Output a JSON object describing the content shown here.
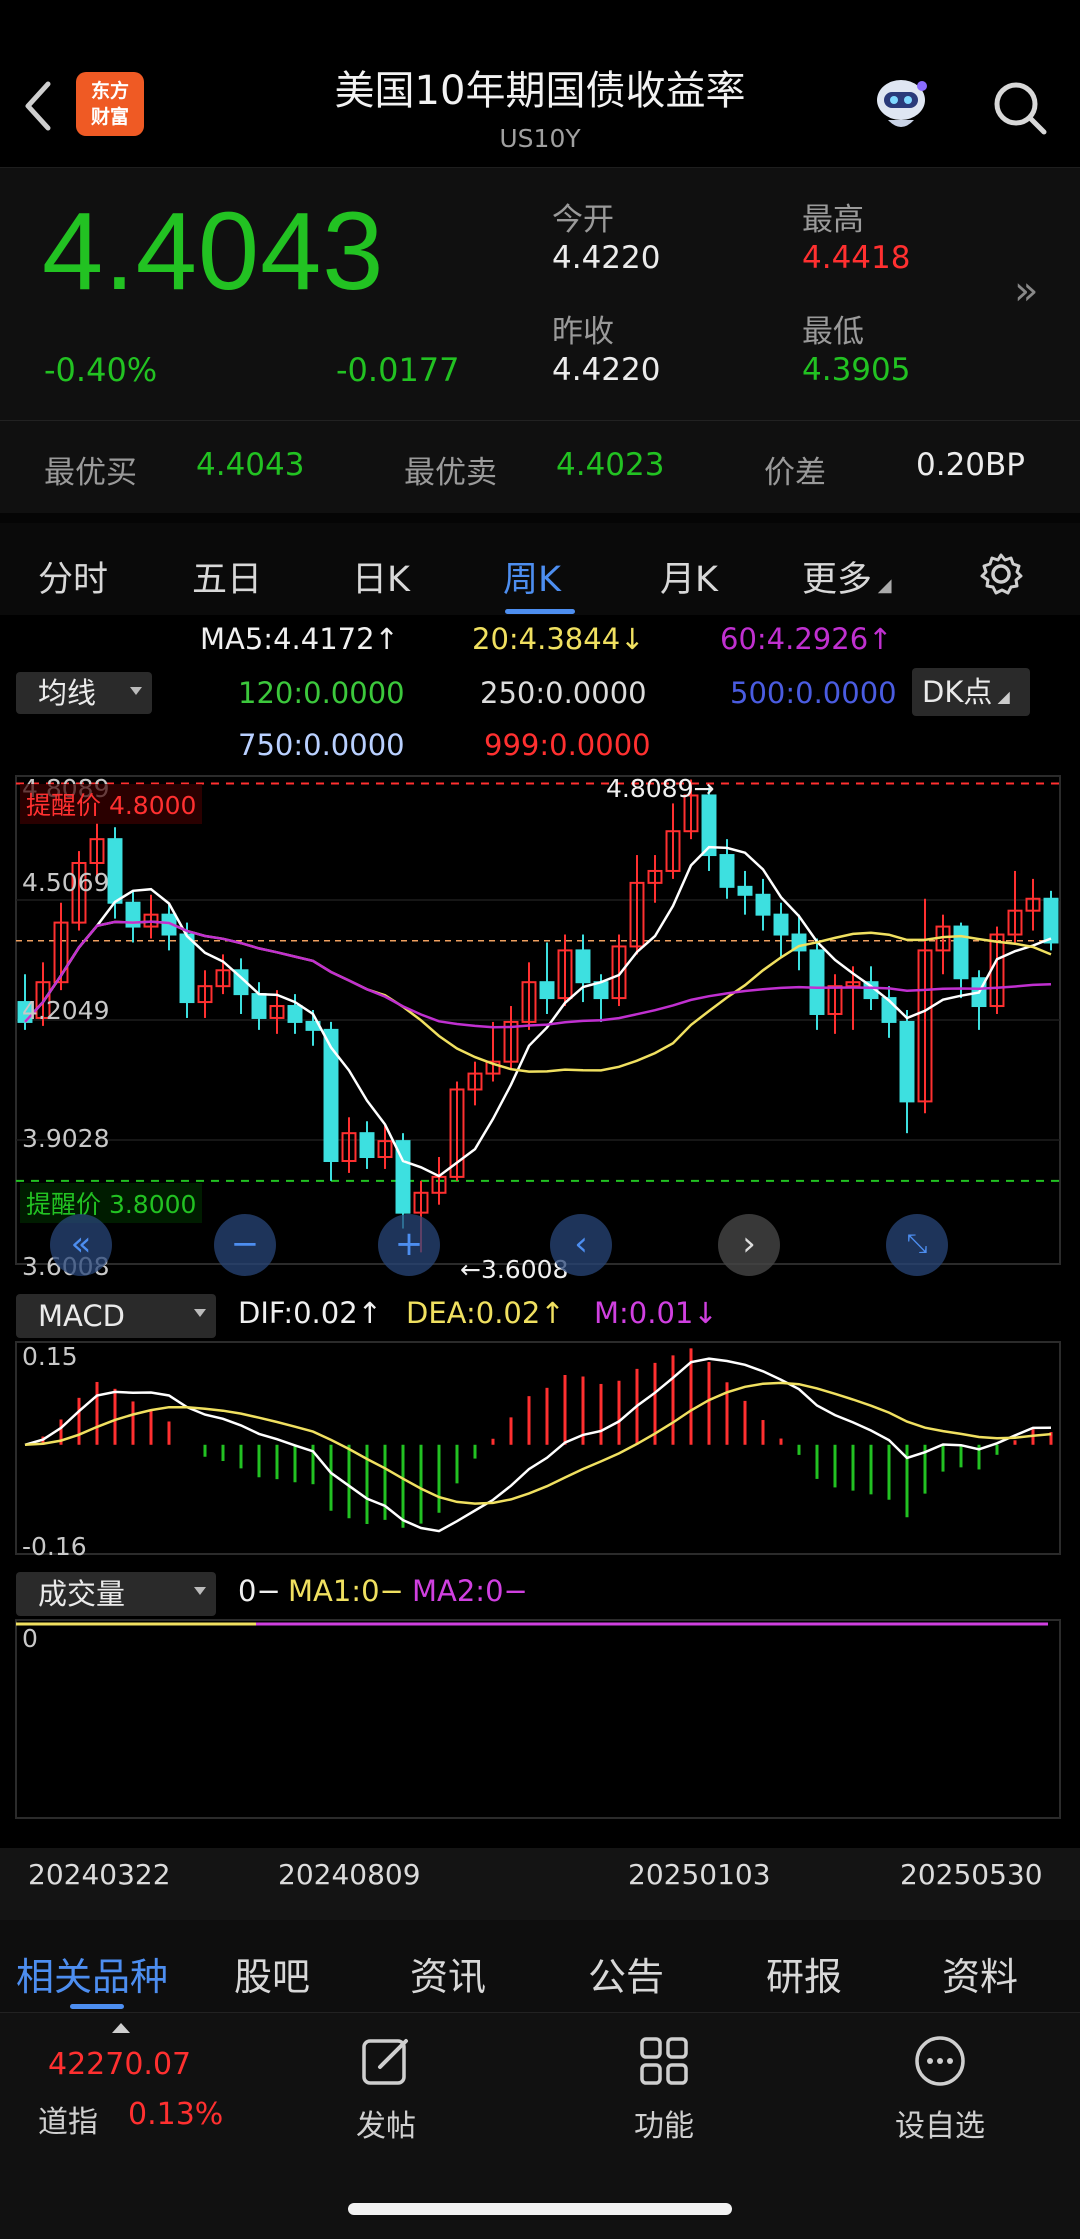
{
  "header": {
    "title": "美国10年期国债收益率",
    "subtitle": "US10Y",
    "logo_text_line1": "东方",
    "logo_text_line2": "财富"
  },
  "quote": {
    "price": "4.4043",
    "change_pct": "-0.40%",
    "change": "-0.0177",
    "open_label": "今开",
    "open": "4.4220",
    "high_label": "最高",
    "high": "4.4418",
    "prev_close_label": "昨收",
    "prev_close": "4.4220",
    "low_label": "最低",
    "low": "4.3905"
  },
  "bidask": {
    "bid_label": "最优买",
    "bid": "4.4043",
    "ask_label": "最优卖",
    "ask": "4.4023",
    "spread_label": "价差",
    "spread": "0.20BP"
  },
  "period_tabs": [
    "分时",
    "五日",
    "日K",
    "周K",
    "月K",
    "更多"
  ],
  "active_period": "周K",
  "ma_legend": {
    "selector": "均线",
    "ma5": "MA5:4.4172↑",
    "ma20": "20:4.3844↓",
    "ma60": "60:4.2926↑",
    "ma120": "120:0.0000",
    "ma250": "250:0.0000",
    "ma500": "500:0.0000",
    "ma750": "750:0.0000",
    "ma999": "999:0.0000",
    "dk_button": "DK点"
  },
  "kline": {
    "y_labels": [
      "4.8089",
      "4.5069",
      "4.2049",
      "3.9028",
      "3.6008"
    ],
    "alert_high": "提醒价 4.8000",
    "alert_low": "提醒价 3.8000",
    "max_marker": "4.8089→",
    "min_marker": "←3.6008",
    "colors": {
      "up": "#ff3030",
      "down": "#3de0e0",
      "ma5": "#ffffff",
      "ma20": "#f0e060",
      "ma60": "#c030d0"
    }
  },
  "macd": {
    "selector": "MACD",
    "dif": "DIF:0.02↑",
    "dea": "DEA:0.02↑",
    "m": "M:0.01↓",
    "y_top": "0.15",
    "y_bottom": "-0.16"
  },
  "volume": {
    "selector": "成交量",
    "value": "0−",
    "ma1": "MA1:0−",
    "ma2": "MA2:0−",
    "y_label": "0"
  },
  "dates": [
    "20240322",
    "20240809",
    "20250103",
    "20250530"
  ],
  "info_tabs": [
    "相关品种",
    "股吧",
    "资讯",
    "公告",
    "研报",
    "资料"
  ],
  "bottom_bar": {
    "index_value": "42270.07",
    "index_name": "道指",
    "index_pct": "0.13%",
    "post_label": "发帖",
    "function_label": "功能",
    "watchlist_label": "设自选"
  },
  "chart_data": {
    "type": "candlestick",
    "title": "",
    "ylim": [
      3.6008,
      4.8089
    ],
    "note_axis": "weekly candles, open/close/high/low in yield %",
    "candles": [
      [
        4.25,
        4.2,
        4.32,
        4.18
      ],
      [
        4.21,
        4.3,
        4.35,
        4.19
      ],
      [
        4.3,
        4.45,
        4.5,
        4.28
      ],
      [
        4.45,
        4.6,
        4.63,
        4.43
      ],
      [
        4.6,
        4.66,
        4.7,
        4.55
      ],
      [
        4.66,
        4.5,
        4.69,
        4.46
      ],
      [
        4.5,
        4.44,
        4.53,
        4.4
      ],
      [
        4.44,
        4.47,
        4.52,
        4.41
      ],
      [
        4.47,
        4.42,
        4.5,
        4.38
      ],
      [
        4.42,
        4.25,
        4.45,
        4.21
      ],
      [
        4.25,
        4.29,
        4.33,
        4.21
      ],
      [
        4.29,
        4.33,
        4.37,
        4.27
      ],
      [
        4.33,
        4.27,
        4.36,
        4.22
      ],
      [
        4.27,
        4.21,
        4.3,
        4.18
      ],
      [
        4.21,
        4.24,
        4.28,
        4.17
      ],
      [
        4.24,
        4.2,
        4.27,
        4.17
      ],
      [
        4.2,
        4.18,
        4.23,
        4.14
      ],
      [
        4.18,
        3.85,
        4.2,
        3.8
      ],
      [
        3.85,
        3.92,
        3.96,
        3.82
      ],
      [
        3.92,
        3.86,
        3.95,
        3.83
      ],
      [
        3.86,
        3.9,
        3.94,
        3.83
      ],
      [
        3.9,
        3.72,
        3.92,
        3.68
      ],
      [
        3.72,
        3.77,
        3.8,
        3.62
      ],
      [
        3.77,
        3.81,
        3.86,
        3.74
      ],
      [
        3.81,
        4.03,
        4.05,
        3.8
      ],
      [
        4.03,
        4.07,
        4.1,
        3.99
      ],
      [
        4.07,
        4.1,
        4.2,
        4.05
      ],
      [
        4.1,
        4.2,
        4.24,
        4.08
      ],
      [
        4.2,
        4.3,
        4.35,
        4.18
      ],
      [
        4.3,
        4.26,
        4.4,
        4.22
      ],
      [
        4.26,
        4.38,
        4.42,
        4.24
      ],
      [
        4.38,
        4.3,
        4.42,
        4.25
      ],
      [
        4.3,
        4.26,
        4.32,
        4.2
      ],
      [
        4.26,
        4.39,
        4.42,
        4.24
      ],
      [
        4.39,
        4.55,
        4.62,
        4.37
      ],
      [
        4.55,
        4.58,
        4.62,
        4.5
      ],
      [
        4.58,
        4.68,
        4.75,
        4.56
      ],
      [
        4.68,
        4.77,
        4.81,
        4.66
      ],
      [
        4.77,
        4.62,
        4.79,
        4.58
      ],
      [
        4.62,
        4.54,
        4.66,
        4.51
      ],
      [
        4.54,
        4.52,
        4.58,
        4.47
      ],
      [
        4.52,
        4.47,
        4.56,
        4.43
      ],
      [
        4.47,
        4.42,
        4.5,
        4.36
      ],
      [
        4.42,
        4.38,
        4.47,
        4.33
      ],
      [
        4.38,
        4.22,
        4.41,
        4.18
      ],
      [
        4.22,
        4.29,
        4.32,
        4.17
      ],
      [
        4.29,
        4.3,
        4.34,
        4.18
      ],
      [
        4.3,
        4.26,
        4.34,
        4.23
      ],
      [
        4.26,
        4.2,
        4.29,
        4.16
      ],
      [
        4.2,
        4.0,
        4.23,
        3.92
      ],
      [
        4.0,
        4.38,
        4.51,
        3.97
      ],
      [
        4.38,
        4.44,
        4.47,
        4.32
      ],
      [
        4.44,
        4.31,
        4.45,
        4.26
      ],
      [
        4.31,
        4.24,
        4.33,
        4.18
      ],
      [
        4.24,
        4.42,
        4.44,
        4.22
      ],
      [
        4.42,
        4.48,
        4.58,
        4.4
      ],
      [
        4.48,
        4.51,
        4.56,
        4.43
      ],
      [
        4.51,
        4.4,
        4.53,
        4.38
      ]
    ]
  }
}
